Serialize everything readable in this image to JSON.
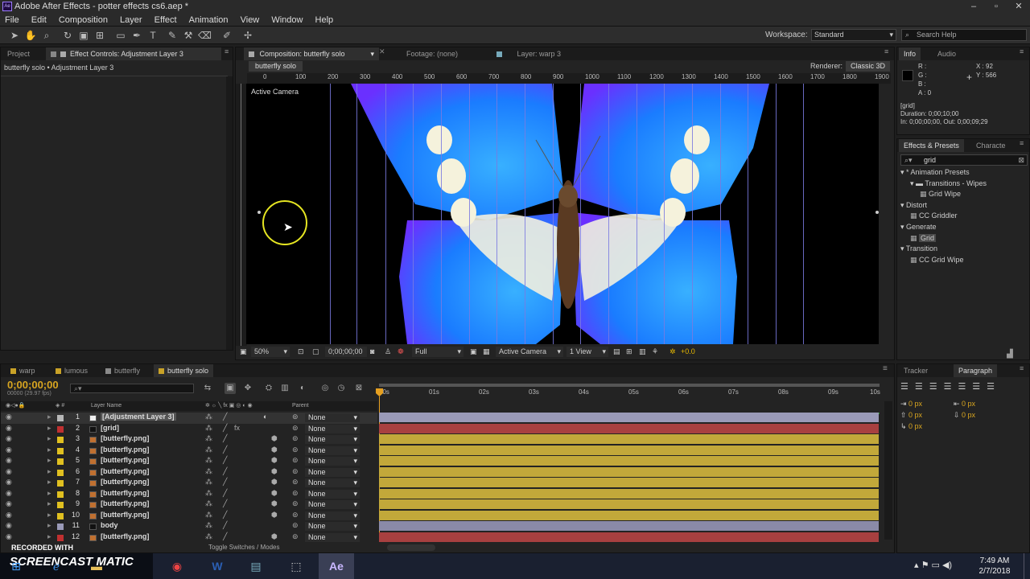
{
  "window": {
    "title": "Adobe After Effects - potter effects cs6.aep *",
    "app_icon": "Ae"
  },
  "menu": [
    "File",
    "Edit",
    "Composition",
    "Layer",
    "Effect",
    "Animation",
    "View",
    "Window",
    "Help"
  ],
  "toolbar": {
    "workspace_label": "Workspace:",
    "workspace_value": "Standard",
    "search_placeholder": "Search Help"
  },
  "left_panel": {
    "tabs": [
      "Project",
      "Effect Controls: Adjustment Layer 3"
    ],
    "breadcrumb": "butterfly solo • Adjustment Layer 3"
  },
  "composition": {
    "tabs": [
      "Composition: butterfly solo",
      "Footage: (none)",
      "Layer: warp 3"
    ],
    "subtab": "butterfly solo",
    "renderer_label": "Renderer:",
    "renderer_value": "Classic 3D",
    "camera_label": "Active Camera",
    "ruler_ticks": [
      "0",
      "100",
      "200",
      "300",
      "400",
      "500",
      "600",
      "700",
      "800",
      "900",
      "1000",
      "1100",
      "1200",
      "1300",
      "1400",
      "1500",
      "1600",
      "1700",
      "1800",
      "1900"
    ],
    "footer": {
      "zoom": "50%",
      "timecode": "0;00;00;00",
      "resolution": "Full",
      "view": "Active Camera",
      "views": "1 View",
      "exposure": "+0.0"
    }
  },
  "info": {
    "tabs": [
      "Info",
      "Audio"
    ],
    "r": "R :",
    "g": "G :",
    "b": "B :",
    "a": "A : 0",
    "x": "X : 92",
    "y": "Y : 566",
    "layer": "[grid]",
    "duration": "Duration: 0;00;10;00",
    "inout": "In: 0;00;00;00, Out: 0;00;09;29"
  },
  "effects": {
    "tabs": [
      "Effects & Presets",
      "Characte"
    ],
    "search_value": "grid",
    "tree": [
      {
        "label": "* Animation Presets",
        "indent": 0,
        "kind": "group"
      },
      {
        "label": "Transitions - Wipes",
        "indent": 1,
        "kind": "folder"
      },
      {
        "label": "Grid Wipe",
        "indent": 2,
        "kind": "preset"
      },
      {
        "label": "Distort",
        "indent": 0,
        "kind": "group"
      },
      {
        "label": "CC Griddler",
        "indent": 1,
        "kind": "effect"
      },
      {
        "label": "Generate",
        "indent": 0,
        "kind": "group"
      },
      {
        "label": "Grid",
        "indent": 1,
        "kind": "effect",
        "selected": true
      },
      {
        "label": "Transition",
        "indent": 0,
        "kind": "group"
      },
      {
        "label": "CC Grid Wipe",
        "indent": 1,
        "kind": "effect"
      }
    ]
  },
  "timeline": {
    "tabs": [
      "warp",
      "lumous",
      "butterfly",
      "butterfly solo"
    ],
    "tab_colors": [
      "#c9a227",
      "#c9a227",
      "#8a8a8a",
      "#c9a227"
    ],
    "timecode": "0;00;00;00",
    "fps": "00000 (29.97 fps)",
    "col_layer": "Layer Name",
    "col_parent": "Parent",
    "time_ticks": [
      "00s",
      "01s",
      "02s",
      "03s",
      "04s",
      "05s",
      "06s",
      "07s",
      "08s",
      "09s",
      "10s"
    ],
    "footer": "Toggle Switches / Modes",
    "layers": [
      {
        "num": "1",
        "name": "[Adjustment Layer 3]",
        "color": "#b8b8b8",
        "parent": "None",
        "bar": "#9a9ab8",
        "selected": true
      },
      {
        "num": "2",
        "name": "[grid]",
        "color": "#c03030",
        "parent": "None",
        "bar": "#a84040"
      },
      {
        "num": "3",
        "name": "[butterfly.png]",
        "color": "#e0c020",
        "parent": "None",
        "bar": "#c2a83a"
      },
      {
        "num": "4",
        "name": "[butterfly.png]",
        "color": "#e0c020",
        "parent": "None",
        "bar": "#c2a83a"
      },
      {
        "num": "5",
        "name": "[butterfly.png]",
        "color": "#e0c020",
        "parent": "None",
        "bar": "#c2a83a"
      },
      {
        "num": "6",
        "name": "[butterfly.png]",
        "color": "#e0c020",
        "parent": "None",
        "bar": "#c2a83a"
      },
      {
        "num": "7",
        "name": "[butterfly.png]",
        "color": "#e0c020",
        "parent": "None",
        "bar": "#c2a83a"
      },
      {
        "num": "8",
        "name": "[butterfly.png]",
        "color": "#e0c020",
        "parent": "None",
        "bar": "#c2a83a"
      },
      {
        "num": "9",
        "name": "[butterfly.png]",
        "color": "#e0c020",
        "parent": "None",
        "bar": "#c2a83a"
      },
      {
        "num": "10",
        "name": "[butterfly.png]",
        "color": "#e0c020",
        "parent": "None",
        "bar": "#c2a83a"
      },
      {
        "num": "11",
        "name": "body",
        "color": "#9a9ab8",
        "parent": "None",
        "bar": "#8a8aa8"
      },
      {
        "num": "12",
        "name": "[butterfly.png]",
        "color": "#c03030",
        "parent": "None",
        "bar": "#a84040"
      }
    ]
  },
  "paragraph": {
    "tabs": [
      "Tracker",
      "Paragraph"
    ],
    "values": [
      "0 px",
      "0 px",
      "0 px",
      "0 px",
      "0 px"
    ]
  },
  "taskbar": {
    "watermark": "SCREENCAST MATIC",
    "recorded": "RECORDED WITH",
    "time": "7:49 AM",
    "date": "2/7/2018",
    "apps": [
      "start-icon",
      "ie-icon",
      "file-explorer-icon",
      "chrome-icon",
      "word-icon",
      "window-icon",
      "snipping-icon",
      "after-effects-icon"
    ]
  },
  "colors": {
    "accent": "#d8a520",
    "grid_line": "#7a7ae0",
    "wing_blue": "#1a8cff"
  }
}
